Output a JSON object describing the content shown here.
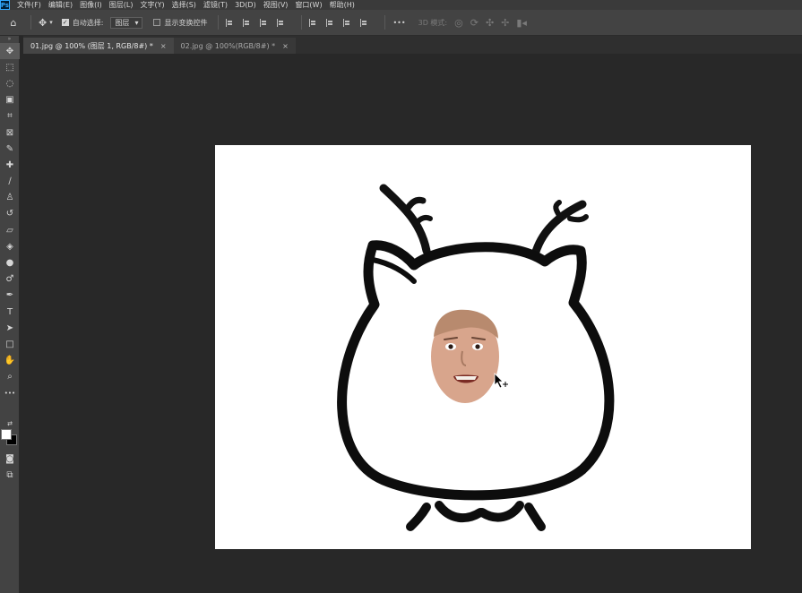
{
  "app": {
    "logo_text": "Ps"
  },
  "menu": [
    {
      "label": "文件(F)"
    },
    {
      "label": "编辑(E)"
    },
    {
      "label": "图像(I)"
    },
    {
      "label": "图层(L)"
    },
    {
      "label": "文字(Y)"
    },
    {
      "label": "选择(S)"
    },
    {
      "label": "滤镜(T)"
    },
    {
      "label": "3D(D)"
    },
    {
      "label": "视图(V)"
    },
    {
      "label": "窗口(W)"
    },
    {
      "label": "帮助(H)"
    }
  ],
  "options": {
    "auto_select_label": "自动选择:",
    "auto_select_checked": true,
    "auto_select_target": "图层",
    "show_transform_label": "显示变换控件",
    "show_transform_checked": false,
    "more_label": "•••",
    "mode_3d_label": "3D 模式:"
  },
  "tabs": [
    {
      "label": "01.jpg @ 100% (图层 1, RGB/8#) *",
      "active": true
    },
    {
      "label": "02.jpg @ 100%(RGB/8#) *",
      "active": false
    }
  ],
  "tools": [
    {
      "name": "move-tool",
      "glyph": "✥"
    },
    {
      "name": "marquee-tool",
      "glyph": "⬚"
    },
    {
      "name": "lasso-tool",
      "glyph": "◌"
    },
    {
      "name": "object-select-tool",
      "glyph": "▣"
    },
    {
      "name": "crop-tool",
      "glyph": "⌗"
    },
    {
      "name": "frame-tool",
      "glyph": "⊠"
    },
    {
      "name": "eyedropper-tool",
      "glyph": "✎"
    },
    {
      "name": "healing-brush-tool",
      "glyph": "✚"
    },
    {
      "name": "brush-tool",
      "glyph": "∕"
    },
    {
      "name": "clone-stamp-tool",
      "glyph": "♙"
    },
    {
      "name": "history-brush-tool",
      "glyph": "↺"
    },
    {
      "name": "eraser-tool",
      "glyph": "▱"
    },
    {
      "name": "paint-bucket-tool",
      "glyph": "◈"
    },
    {
      "name": "blur-tool",
      "glyph": "●"
    },
    {
      "name": "dodge-tool",
      "glyph": "♂"
    },
    {
      "name": "pen-tool",
      "glyph": "✒"
    },
    {
      "name": "type-tool",
      "glyph": "T"
    },
    {
      "name": "path-selection-tool",
      "glyph": "➤"
    },
    {
      "name": "rectangle-tool",
      "glyph": "□"
    },
    {
      "name": "hand-tool",
      "glyph": "✋"
    },
    {
      "name": "zoom-tool",
      "glyph": "⌕"
    },
    {
      "name": "more-tools",
      "glyph": "•••"
    }
  ],
  "colors": {
    "foreground": "#ffffff",
    "background": "#000000"
  }
}
